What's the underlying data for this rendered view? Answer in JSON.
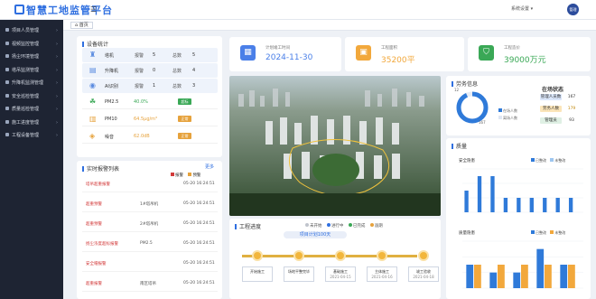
{
  "app": {
    "title": "智慧工地监管平台"
  },
  "header": {
    "user_menu_label": "系统设置",
    "avatar_text": "管理"
  },
  "tabs": [
    {
      "label": "首页"
    }
  ],
  "sidebar": {
    "items": [
      {
        "label": "项目人员管理"
      },
      {
        "label": "视频监控管理"
      },
      {
        "label": "扬尘环境管理"
      },
      {
        "label": "塔吊监测管理"
      },
      {
        "label": "升降机监测管理"
      },
      {
        "label": "安全巡检管理"
      },
      {
        "label": "质量巡检管理"
      },
      {
        "label": "施工进度管理"
      },
      {
        "label": "工程设备管理"
      }
    ]
  },
  "device_stats": {
    "title": "设备统计",
    "rows": [
      {
        "name": "塔机",
        "alarm_label": "报警",
        "alarm": "5",
        "total_label": "总数",
        "total": "5"
      },
      {
        "name": "升降机",
        "alarm_label": "报警",
        "alarm": "0",
        "total_label": "总数",
        "total": "4"
      },
      {
        "name": "AI识别",
        "alarm_label": "报警",
        "alarm": "1",
        "total_label": "总数",
        "total": "3"
      }
    ],
    "env": [
      {
        "name": "PM2.5",
        "value": "40.0%",
        "status": "超标",
        "color": "#3aa856"
      },
      {
        "name": "PM10",
        "value": "64.5μg/m³",
        "status": "正常",
        "color": "#e6a23c"
      },
      {
        "name": "噪音",
        "value": "62.0dB",
        "status": "正常",
        "color": "#e6a23c"
      }
    ]
  },
  "alarm_list": {
    "title": "实时报警列表",
    "more": "更多",
    "legend": [
      "报警",
      "预警"
    ],
    "rows": [
      {
        "type": "塔吊超重报警",
        "device": "",
        "time": "05-20 16:24:51"
      },
      {
        "type": "超重预警",
        "device": "1#塔吊机",
        "time": "05-20 16:24:51"
      },
      {
        "type": "超重预警",
        "device": "2#塔吊机",
        "time": "05-20 16:24:51"
      },
      {
        "type": "扬尘浓度超标报警",
        "device": "PM2.5",
        "time": "05-20 16:24:51"
      },
      {
        "type": "安全帽报警",
        "device": "",
        "time": "05-20 16:24:51"
      },
      {
        "type": "超重报警",
        "device": "南区塔吊",
        "time": "05-20 16:24:51"
      }
    ]
  },
  "stats": [
    {
      "label": "计划竣工时间",
      "value": "2024-11-30",
      "color": "#4a7fe8",
      "icon": "calendar-icon"
    },
    {
      "label": "工程面积",
      "value": "35200平",
      "color": "#f2a83c",
      "icon": "box-icon"
    },
    {
      "label": "工程造价",
      "value": "39000万元",
      "color": "#3aa856",
      "icon": "shield-icon"
    }
  ],
  "attendance": {
    "title": "劳务信息",
    "total": "167",
    "top": "12",
    "legend": [
      "在场人数",
      "离场人数"
    ],
    "status_title": "在场状态",
    "rows": [
      {
        "label": "管理人员数",
        "value": "167",
        "color": "#dbe7fb",
        "text": "#333"
      },
      {
        "label": "劳务人数",
        "value": "179",
        "color": "#fbe5b9",
        "text": "#c28a10"
      },
      {
        "label": "管理员",
        "value": "93",
        "color": "#dff0e4",
        "text": "#333"
      }
    ]
  },
  "quality": {
    "title": "质量",
    "safety_label": "安全隐患",
    "quality_label": "质量隐患",
    "legend": [
      "已整改",
      "未整改"
    ]
  },
  "progress": {
    "title": "工程进度",
    "legend": [
      "未开始",
      "进行中",
      "已完成",
      "逾期"
    ],
    "plan_label": "项目计划100天",
    "milestones": [
      {
        "name": "开始施工",
        "date": ""
      },
      {
        "name": "场地平整完毕",
        "date": ""
      },
      {
        "name": "基础施工",
        "date": "2021-04-15"
      },
      {
        "name": "主体施工",
        "date": "2021-04-16"
      },
      {
        "name": "竣工验收",
        "date": "2021-04-18"
      }
    ]
  },
  "chart_data": [
    {
      "type": "pie",
      "title": "劳务信息",
      "categories": [
        "在场人数",
        "离场人数"
      ],
      "values": [
        167,
        12
      ]
    },
    {
      "type": "bar",
      "title": "安全隐患",
      "categories": [
        "1",
        "2",
        "3",
        "4",
        "5",
        "6",
        "7",
        "8",
        "9"
      ],
      "series": [
        {
          "name": "已整改",
          "values": [
            3,
            5,
            5,
            2,
            2,
            2,
            2,
            2,
            2
          ]
        },
        {
          "name": "未整改",
          "values": [
            0,
            0,
            0,
            0,
            0,
            0,
            0,
            0,
            0
          ]
        }
      ],
      "ylim": [
        0,
        6
      ]
    },
    {
      "type": "bar",
      "title": "质量隐患",
      "categories": [
        "1",
        "2",
        "3",
        "4",
        "5"
      ],
      "series": [
        {
          "name": "已整改",
          "values": [
            3,
            2,
            2,
            5,
            3
          ]
        },
        {
          "name": "未整改",
          "values": [
            3,
            3,
            3,
            3,
            3
          ]
        }
      ],
      "ylim": [
        0,
        6
      ]
    }
  ]
}
